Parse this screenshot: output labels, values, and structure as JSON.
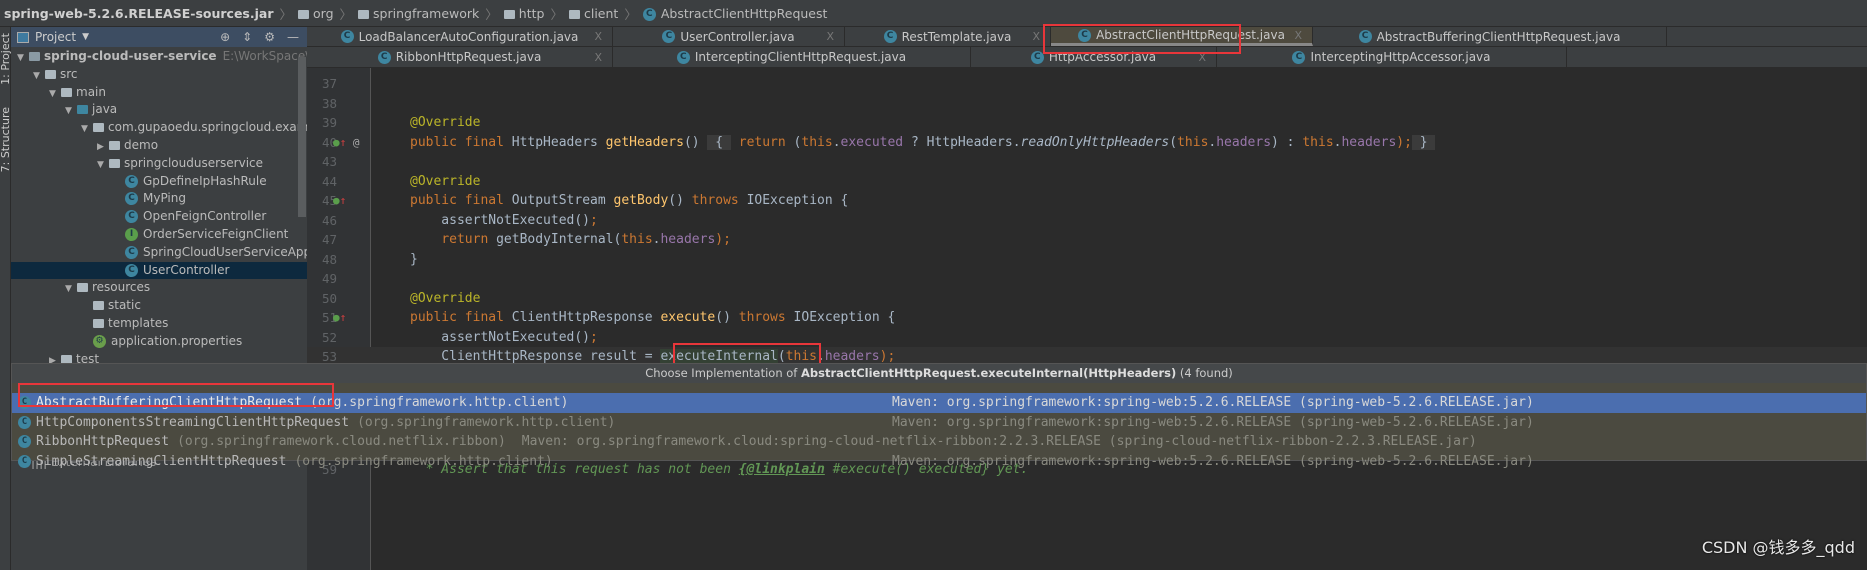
{
  "breadcrumb": {
    "jar": "spring-web-5.2.6.RELEASE-sources.jar",
    "items": [
      "org",
      "springframework",
      "http",
      "client"
    ],
    "class": "AbstractClientHttpRequest"
  },
  "toolstrip": {
    "project": "1: Project",
    "structure": "7: Structure"
  },
  "project_panel": {
    "title": "Project",
    "tree": [
      {
        "label": "spring-cloud-user-service",
        "path": "E:\\WorkSpace\\GuPaoEdu\\",
        "depth": 0,
        "arrow": "down",
        "icon": "module",
        "bold": true
      },
      {
        "label": "src",
        "depth": 1,
        "arrow": "down",
        "icon": "folder"
      },
      {
        "label": "main",
        "depth": 2,
        "arrow": "down",
        "icon": "folder"
      },
      {
        "label": "java",
        "depth": 3,
        "arrow": "down",
        "icon": "folder-source"
      },
      {
        "label": "com.gupaoedu.springcloud.example",
        "depth": 4,
        "arrow": "down",
        "icon": "package"
      },
      {
        "label": "demo",
        "depth": 5,
        "arrow": "right",
        "icon": "package"
      },
      {
        "label": "springclouduserservice",
        "depth": 5,
        "arrow": "down",
        "icon": "package"
      },
      {
        "label": "GpDefineIpHashRule",
        "depth": 6,
        "icon": "class"
      },
      {
        "label": "MyPing",
        "depth": 6,
        "icon": "class"
      },
      {
        "label": "OpenFeignController",
        "depth": 6,
        "icon": "class"
      },
      {
        "label": "OrderServiceFeignClient",
        "depth": 6,
        "icon": "interface"
      },
      {
        "label": "SpringCloudUserServiceApplication",
        "depth": 6,
        "icon": "class"
      },
      {
        "label": "UserController",
        "depth": 6,
        "icon": "class",
        "selected": true
      },
      {
        "label": "resources",
        "depth": 3,
        "arrow": "down",
        "icon": "folder"
      },
      {
        "label": "static",
        "depth": 4,
        "icon": "folder"
      },
      {
        "label": "templates",
        "depth": 4,
        "icon": "folder"
      },
      {
        "label": "application.properties",
        "depth": 4,
        "icon": "properties"
      },
      {
        "label": "test",
        "depth": 2,
        "arrow": "right",
        "icon": "folder"
      }
    ],
    "external": "External Libraries"
  },
  "tabs": {
    "row1": [
      {
        "label": "LoadBalancerAutoConfiguration.java",
        "closable": true
      },
      {
        "label": "UserController.java",
        "closable": true
      },
      {
        "label": "RestTemplate.java",
        "closable": true
      },
      {
        "label": "AbstractClientHttpRequest.java",
        "closable": true,
        "active": true
      },
      {
        "label": "AbstractBufferingClientHttpRequest.java",
        "closable": false
      }
    ],
    "row2": [
      {
        "label": "RibbonHttpRequest.java",
        "closable": true
      },
      {
        "label": "InterceptingClientHttpRequest.java",
        "closable": false
      },
      {
        "label": "HttpAccessor.java",
        "closable": true
      },
      {
        "label": "InterceptingHttpAccessor.java",
        "closable": false
      }
    ]
  },
  "editor": {
    "lines": [
      {
        "n": "37",
        "t": []
      },
      {
        "n": "38",
        "t": []
      },
      {
        "n": "39",
        "t": [
          [
            "@Override",
            "an"
          ]
        ]
      },
      {
        "n": "40",
        "m": "override-at",
        "t": [
          [
            "public final ",
            "kw"
          ],
          [
            "HttpHeaders ",
            "tx"
          ],
          [
            "getHeaders",
            "fn"
          ],
          [
            "() ",
            "tx"
          ],
          [
            " { ",
            "fold-ph"
          ],
          [
            " return ",
            "kw"
          ],
          [
            "(",
            "tx"
          ],
          [
            "this",
            "kw"
          ],
          [
            ".",
            "tx"
          ],
          [
            "executed",
            "fd"
          ],
          [
            " ? HttpHeaders.",
            "tx"
          ],
          [
            "readOnlyHttpHeaders",
            "tx it"
          ],
          [
            "(",
            "tx"
          ],
          [
            "this",
            "kw"
          ],
          [
            ".",
            "tx"
          ],
          [
            "headers",
            "fd"
          ],
          [
            ") : ",
            "tx"
          ],
          [
            "this",
            "kw"
          ],
          [
            ".",
            "tx"
          ],
          [
            "headers",
            "fd"
          ],
          [
            ");",
            "kw"
          ],
          [
            " } ",
            "fold-ph"
          ]
        ]
      },
      {
        "n": "43",
        "t": []
      },
      {
        "n": "44",
        "t": [
          [
            "@Override",
            "an"
          ]
        ]
      },
      {
        "n": "45",
        "m": "override",
        "t": [
          [
            "public final ",
            "kw"
          ],
          [
            "OutputStream ",
            "tx"
          ],
          [
            "getBody",
            "fn"
          ],
          [
            "() ",
            "tx"
          ],
          [
            "throws ",
            "kw"
          ],
          [
            "IOException {",
            "tx"
          ]
        ]
      },
      {
        "n": "46",
        "t": [
          [
            "    assertNotExecuted()",
            "tx"
          ],
          [
            ";",
            "kw"
          ]
        ]
      },
      {
        "n": "47",
        "t": [
          [
            "    ",
            "tx"
          ],
          [
            "return ",
            "kw"
          ],
          [
            "getBodyInternal(",
            "tx"
          ],
          [
            "this",
            "kw"
          ],
          [
            ".",
            "tx"
          ],
          [
            "headers",
            "fd"
          ],
          [
            ");",
            "kw"
          ]
        ]
      },
      {
        "n": "48",
        "t": [
          [
            "}",
            "tx"
          ]
        ]
      },
      {
        "n": "49",
        "t": []
      },
      {
        "n": "50",
        "t": [
          [
            "@Override",
            "an"
          ]
        ]
      },
      {
        "n": "51",
        "m": "override",
        "t": [
          [
            "public final ",
            "kw"
          ],
          [
            "ClientHttpResponse ",
            "tx"
          ],
          [
            "execute",
            "fn"
          ],
          [
            "() ",
            "tx"
          ],
          [
            "throws ",
            "kw"
          ],
          [
            "IOException {",
            "tx"
          ]
        ]
      },
      {
        "n": "52",
        "t": [
          [
            "    assertNotExecuted()",
            "tx"
          ],
          [
            ";",
            "kw"
          ]
        ]
      },
      {
        "n": "53",
        "cur": true,
        "t": [
          [
            "    ClientHttpResponse result = ",
            "tx"
          ],
          [
            "executeInternal",
            "tx hl"
          ],
          [
            "(",
            "tx"
          ],
          [
            "this",
            "kw"
          ],
          [
            ".",
            "tx"
          ],
          [
            "headers",
            "fd"
          ],
          [
            ");",
            "kw"
          ]
        ]
      }
    ],
    "line59": {
      "n": "59",
      "t": [
        [
          "  * Assert that this request has not been ",
          "cm"
        ],
        [
          "{@linkplain",
          "cml"
        ],
        [
          " #execute() executed} yet.",
          "cm"
        ]
      ]
    }
  },
  "popup": {
    "prefix": "Choose Implementation of ",
    "method": "AbstractClientHttpRequest.executeInternal(HttpHeaders)",
    "count": "(4 found)",
    "rows": [
      {
        "name": "AbstractBufferingClientHttpRequest",
        "pkg": "(org.springframework.http.client)",
        "lib": "Maven: org.springframework:spring-web:5.2.6.RELEASE (spring-web-5.2.6.RELEASE.jar)",
        "selected": true,
        "icon": "abstract-class"
      },
      {
        "name": "HttpComponentsStreamingClientHttpRequest",
        "pkg": "(org.springframework.http.client)",
        "lib": "Maven: org.springframework:spring-web:5.2.6.RELEASE (spring-web-5.2.6.RELEASE.jar)",
        "icon": "class"
      },
      {
        "name": "RibbonHttpRequest",
        "pkg": "(org.springframework.cloud.netflix.ribbon)",
        "lib": "Maven: org.springframework.cloud:spring-cloud-netflix-ribbon:2.2.3.RELEASE (spring-cloud-netflix-ribbon-2.2.3.RELEASE.jar)",
        "inline": true,
        "icon": "class"
      },
      {
        "name": "SimpleStreamingClientHttpRequest",
        "pkg": "(org.springframework.http.client)",
        "lib": "Maven: org.springframework:spring-web:5.2.6.RELEASE (spring-web-5.2.6.RELEASE.jar)",
        "icon": "class"
      }
    ]
  },
  "watermark": "CSDN @钱多多_qdd",
  "colors": {
    "keyword": "#cc7832",
    "annotation": "#bbb529",
    "method": "#ffc66d",
    "field": "#9876aa",
    "selection": "#4b6eaf",
    "highlight_box": "#e8363a"
  }
}
